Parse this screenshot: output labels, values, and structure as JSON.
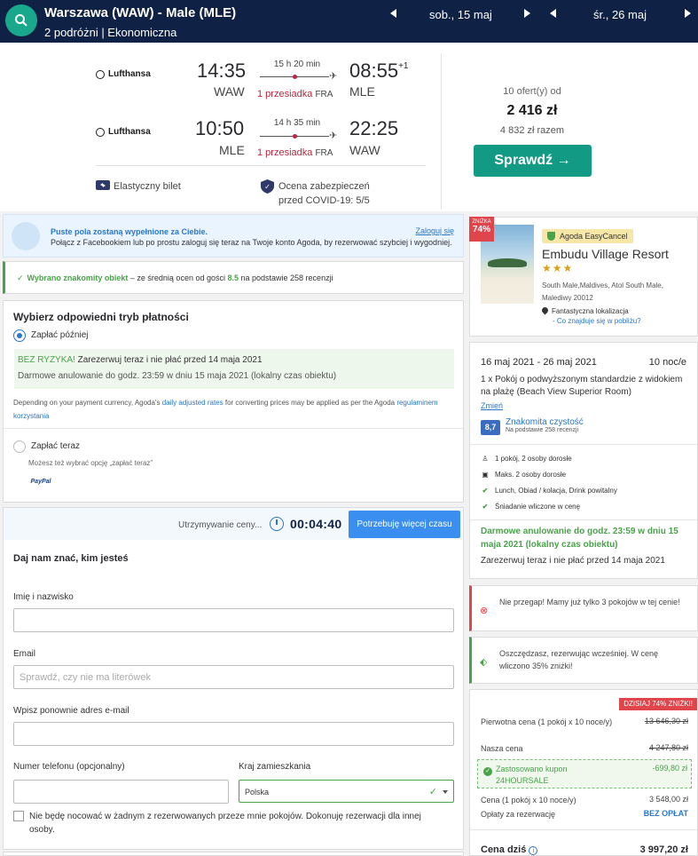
{
  "header": {
    "route": "Warszawa (WAW) - Male (MLE)",
    "trip_info": "2 podróżni | Ekonomiczna",
    "depart_date": "sob., 15 maj",
    "return_date": "śr., 26 maj"
  },
  "flight": {
    "outbound": {
      "airline": "Lufthansa",
      "dep_time": "14:35",
      "dep_code": "WAW",
      "duration": "15 h 20 min",
      "stops": "1 przesiadka",
      "via": "FRA",
      "arr_time": "08:55",
      "arr_offset": "+1",
      "arr_code": "MLE"
    },
    "inbound": {
      "airline": "Lufthansa",
      "dep_time": "10:50",
      "dep_code": "MLE",
      "duration": "14 h 35 min",
      "stops": "1 przesiadka",
      "via": "FRA",
      "arr_time": "22:25",
      "arr_code": "WAW"
    },
    "flexible_label": "Elastyczny bilet",
    "covid_label_1": "Ocena zabezpieczeń",
    "covid_label_2": "przed COVID-19: 5/5",
    "offers": "10 ofert(y) od",
    "price": "2 416 zł",
    "total": "4 832 zł razem",
    "check_button": "Sprawdź →"
  },
  "facebook": {
    "title": "Puste pola zostaną wypełnione za Ciebie.",
    "subtitle": "Połącz z Facebookiem lub po prostu zaloguj się teraz na Twoje konto Agoda, by rezerwować szybciej i wygodniej.",
    "login": "Zaloguj się"
  },
  "known": {
    "strong": "Wybrano znakomity obiekt",
    "text_1": " – ze średnią ocen od gości ",
    "score": "8.5",
    "text_2": " na podstawie 258 recenzji"
  },
  "payment": {
    "title": "Wybierz odpowiedni tryb płatności",
    "later_label": "Zapłać później",
    "norisk_strong": "BEZ RYZYKA!",
    "norisk_text": " Zarezerwuj teraz i nie płać przed 14 maja 2021",
    "free_cancel": "Darmowe anulowanie do godz. 23:59 w dniu 15 maja 2021 (lokalny czas obiektu)",
    "note_1": "Depending on your payment currency, Agoda's ",
    "note_link_1": "daily adjusted rates",
    "note_2": " for converting prices may be applied as per the Agoda ",
    "note_link_2": "regulaminem korzystania",
    "now_label": "Zapłać teraz",
    "now_sub": "Możesz też wybrać opcję „zapłać teraz”",
    "paypal": "PayPal"
  },
  "form": {
    "hold_text": "Utrzymywanie ceny...",
    "timer": "00:04:40",
    "more_time": "Potrzebuję więcej czasu",
    "title": "Daj nam znać, kim jesteś",
    "name_label": "Imię i nazwisko",
    "name_value": "",
    "email_label": "Email",
    "email_placeholder": "Sprawdź, czy nie ma literówek",
    "email2_label": "Wpisz ponownie adres e-mail",
    "phone_label": "Numer telefonu (opcjonalny)",
    "country_label": "Kraj zamieszkania",
    "country_value": "Polska",
    "checkbox_label": "Nie będę nocować w żadnym z rezerwowanych przeze mnie pokojów. Dokonuję rezerwacji dla innej osoby."
  },
  "hotel": {
    "discount_small": "ZNIŻKA",
    "discount": "74%",
    "easy_cancel": "Agoda EasyCancel",
    "name": "Embudu Village Resort",
    "stars": "★★★",
    "address": "South Male,Maldives, Atol South Male, Malediwy 20012",
    "location": "Fantastyczna lokalizacja",
    "nearby": "- Co znajduje się w pobliżu?"
  },
  "stay": {
    "dates": "16 maj 2021 - 26 maj 2021",
    "nights": "10 noc/e",
    "room": "1 x Pokój o podwyższonym standardzie z widokiem na plażę (Beach View Superior Room)",
    "change": "Zmień",
    "score": "8,7",
    "clean": "Znakomita czystość",
    "clean_sub": "Na podstawie 258 recenzji",
    "amenities": [
      "1 pokój, 2 osoby dorosłe",
      "Maks. 2 osoby dorosłe",
      "Lunch, Obiad / kolacja, Drink powitalny",
      "Śniadanie wliczone w cenę"
    ],
    "free_cancel": "Darmowe anulowanie do godz. 23:59 w dniu 15 maja 2021 (lokalny czas obiektu)",
    "pay_later": "Zarezerwuj teraz i nie płać przed 14 maja 2021"
  },
  "alerts": {
    "scarcity": "Nie przegap! Mamy już tylko 3 pokojów w tej cenie!",
    "savings": "Oszczędzasz, rezerwując wcześniej. W cenę wliczono 35% zniżki!"
  },
  "pricing": {
    "today_badge": "DZISIAJ 74% ZNIŻKI!",
    "original_label": "Pierwotna cena (1 pokój x 10 noce/y)",
    "original_value": "13 646,30 zł",
    "our_label": "Nasza cena",
    "our_value": "4 247,80 zł",
    "coupon_label": "Zastosowano kupon",
    "coupon_code": "24HOURSALE",
    "coupon_value": "-699,80 zł",
    "room_label": "Cena (1 pokój x 10 noce/y)",
    "room_value": "3 548,00 zł",
    "fee_label": "Opłaty za rezerwację",
    "fee_value": "BEZ OPŁAT",
    "total_label": "Cena dziś",
    "total_value": "3 997,20 zł"
  }
}
